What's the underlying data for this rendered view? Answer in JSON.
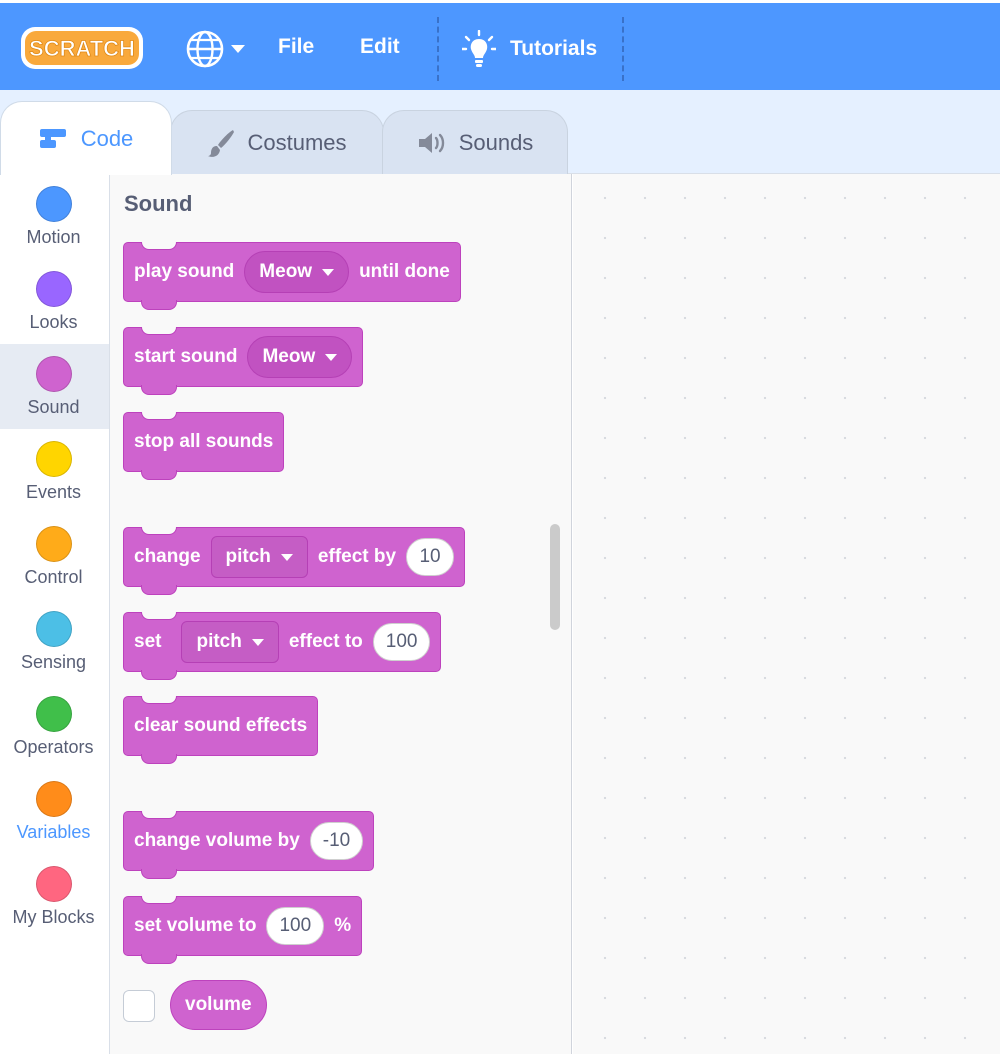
{
  "menubar": {
    "logo_text": "SCRATCH",
    "file_label": "File",
    "edit_label": "Edit",
    "tutorials_label": "Tutorials",
    "background_color": "#4d97ff",
    "icons": [
      "globe-icon",
      "chevron-down-icon",
      "lightbulb-icon"
    ]
  },
  "tabs": [
    {
      "label": "Code",
      "icon": "code-blocks-icon",
      "active": true
    },
    {
      "label": "Costumes",
      "icon": "paintbrush-icon",
      "active": false
    },
    {
      "label": "Sounds",
      "icon": "speaker-icon",
      "active": false
    }
  ],
  "categories": [
    {
      "label": "Motion",
      "color": "#4c97ff"
    },
    {
      "label": "Looks",
      "color": "#9966ff"
    },
    {
      "label": "Sound",
      "color": "#cf63cf",
      "selected": true
    },
    {
      "label": "Events",
      "color": "#ffd500"
    },
    {
      "label": "Control",
      "color": "#ffab19"
    },
    {
      "label": "Sensing",
      "color": "#4cbfe6"
    },
    {
      "label": "Operators",
      "color": "#40bf4a"
    },
    {
      "label": "Variables",
      "color": "#ff8c1a"
    },
    {
      "label": "My Blocks",
      "color": "#ff6680"
    }
  ],
  "palette": {
    "title": "Sound",
    "block_color": "#cf63cf",
    "blocks": {
      "play_sound": {
        "text1": "play sound",
        "menu": "Meow",
        "text2": "until done"
      },
      "start_sound": {
        "text1": "start sound",
        "menu": "Meow"
      },
      "stop_all": {
        "text1": "stop all sounds"
      },
      "change_effect": {
        "text1": "change",
        "menu": "pitch",
        "text2": "effect by",
        "value": "10"
      },
      "set_effect": {
        "text1": "set",
        "menu": "pitch",
        "text2": "effect to",
        "value": "100"
      },
      "clear_effects": {
        "text1": "clear sound effects"
      },
      "change_volume": {
        "text1": "change volume by",
        "value": "-10"
      },
      "set_volume": {
        "text1": "set volume to",
        "value": "100",
        "text2": "%"
      },
      "volume_reporter": {
        "text1": "volume"
      }
    }
  }
}
